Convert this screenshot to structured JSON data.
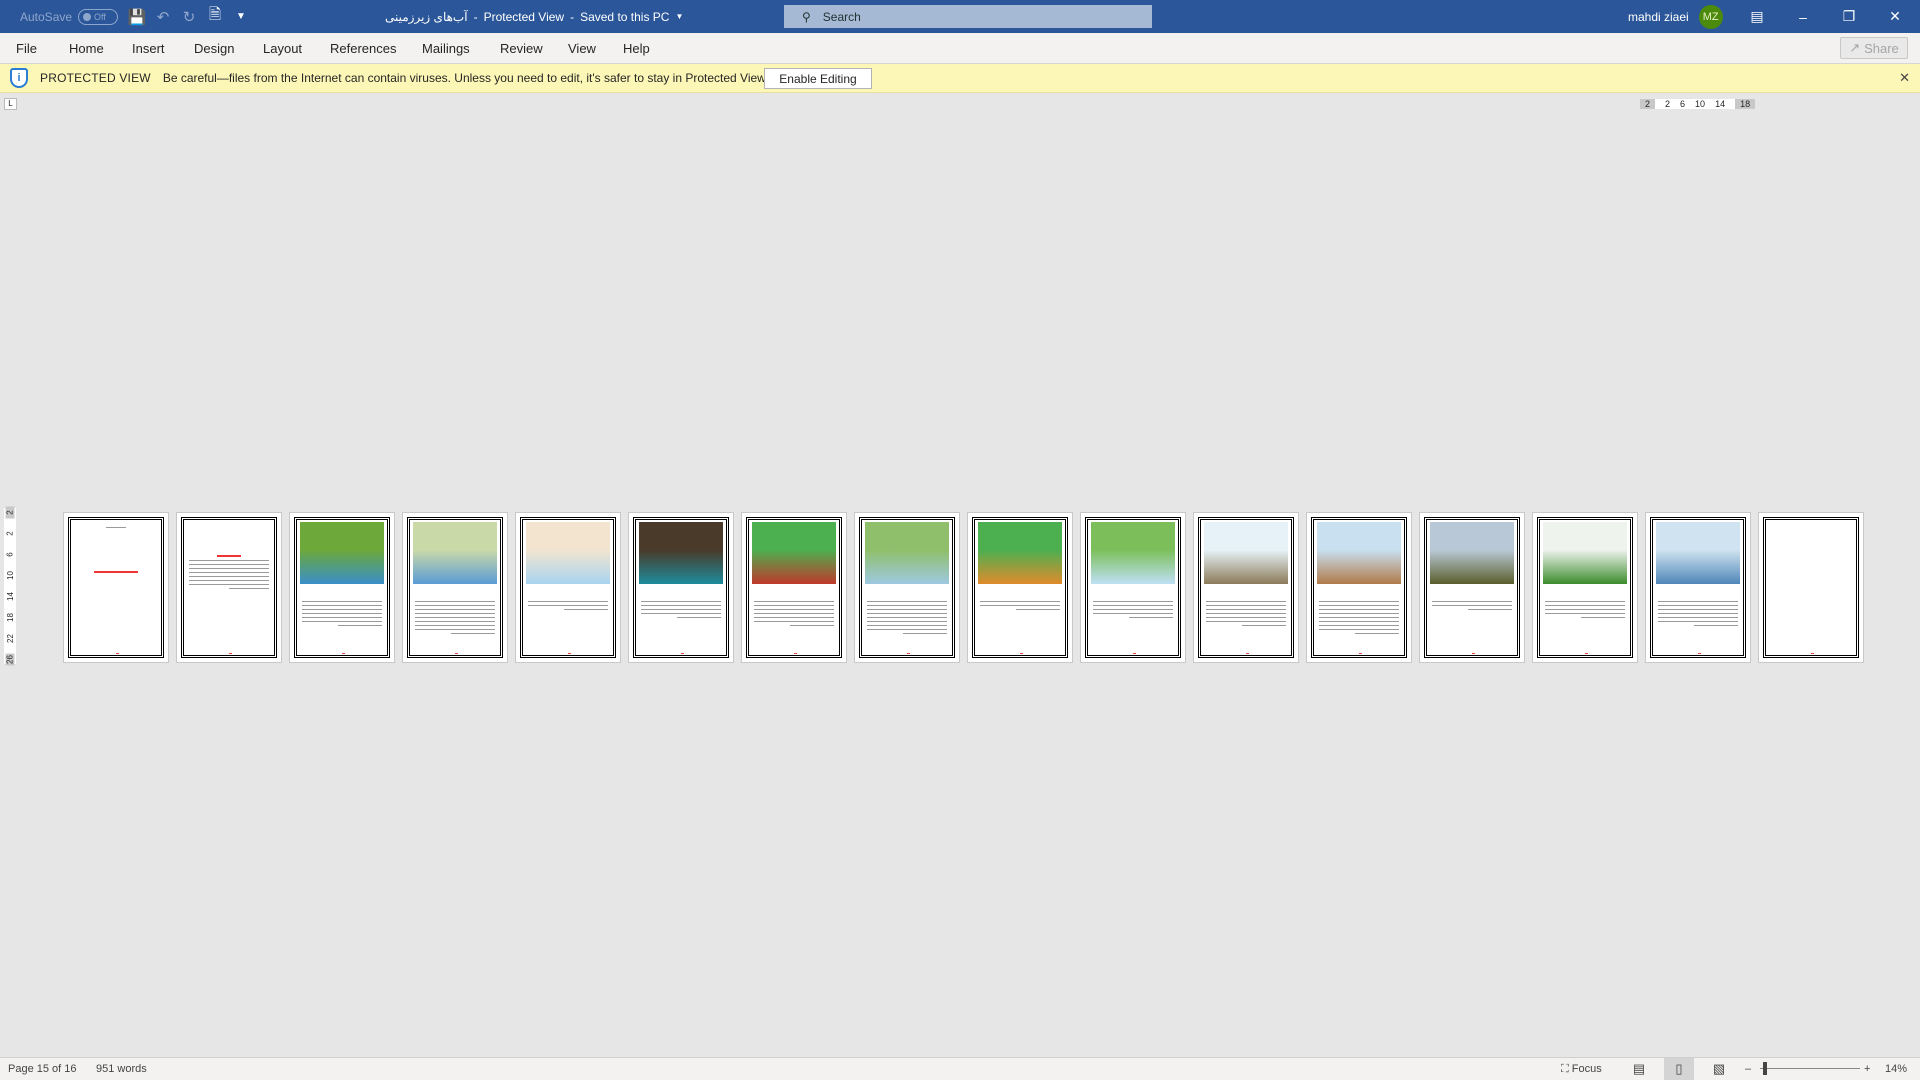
{
  "titlebar": {
    "autosave_label": "AutoSave",
    "autosave_state": "Off",
    "doc_title": "آب‌های زیرزمینی",
    "separator": "-",
    "mode": "Protected View",
    "save_status": "Saved to this PC",
    "search_placeholder": "Search",
    "user_name": "mahdi ziaei",
    "user_initials": "MZ",
    "accent": "#2b579a"
  },
  "ribbon": {
    "tabs": [
      "File",
      "Home",
      "Insert",
      "Design",
      "Layout",
      "References",
      "Mailings",
      "Review",
      "View",
      "Help"
    ],
    "share_label": "Share"
  },
  "protected_bar": {
    "title": "PROTECTED VIEW",
    "message": "Be careful—files from the Internet can contain viruses. Unless you need to edit, it's safer to stay in Protected View.",
    "button": "Enable Editing",
    "background": "#fcf7b6"
  },
  "ruler": {
    "horizontal": [
      "2",
      "2",
      "6",
      "10",
      "14",
      "18"
    ],
    "vertical": [
      "2",
      "2",
      "6",
      "10",
      "14",
      "18",
      "22",
      "26"
    ],
    "corner": "L"
  },
  "pages": [
    {
      "figure": "none",
      "layout": "title"
    },
    {
      "figure": "none",
      "layout": "text"
    },
    {
      "figure": "groundwater-block-diagram",
      "colors": [
        "#6ca83a",
        "#3a8fc9"
      ]
    },
    {
      "figure": "farmland-aquifer-diagram",
      "colors": [
        "#c9d9a8",
        "#5b9bd5"
      ]
    },
    {
      "figure": "water-table-cross-section",
      "colors": [
        "#f2e4cf",
        "#a8d4f0"
      ]
    },
    {
      "figure": "cave-water-photo",
      "colors": [
        "#4a3a2a",
        "#1e8c9c"
      ]
    },
    {
      "figure": "aquifer-layers-diagram",
      "colors": [
        "#4caf50",
        "#c0392b"
      ]
    },
    {
      "figure": "valley-diagram",
      "colors": [
        "#8fbf6a",
        "#9ec9e2"
      ]
    },
    {
      "figure": "soil-layers-tree",
      "colors": [
        "#4caf50",
        "#e08b2c"
      ]
    },
    {
      "figure": "water-cycle-diagram",
      "colors": [
        "#7cbf5a",
        "#bfe0f5"
      ]
    },
    {
      "figure": "groundwater-pollution-infographic",
      "colors": [
        "#e6f2f7",
        "#8c7b5a"
      ]
    },
    {
      "figure": "landfill-cross-section",
      "colors": [
        "#c8e0f0",
        "#b07a4a"
      ]
    },
    {
      "figure": "dry-cracked-land-photo",
      "colors": [
        "#b9c8d6",
        "#5a5e2c"
      ]
    },
    {
      "figure": "irrigation-pipe-photo",
      "colors": [
        "#eef3ee",
        "#3c8c2c"
      ]
    },
    {
      "figure": "wells-aquifer-diagram",
      "colors": [
        "#cfe3f0",
        "#4f86b8"
      ]
    },
    {
      "figure": "none",
      "layout": "blank"
    }
  ],
  "statusbar": {
    "page_info": "Page 15 of 16",
    "word_count": "951 words",
    "focus_label": "Focus",
    "zoom_level": "14%",
    "zoom_percent": 14
  }
}
